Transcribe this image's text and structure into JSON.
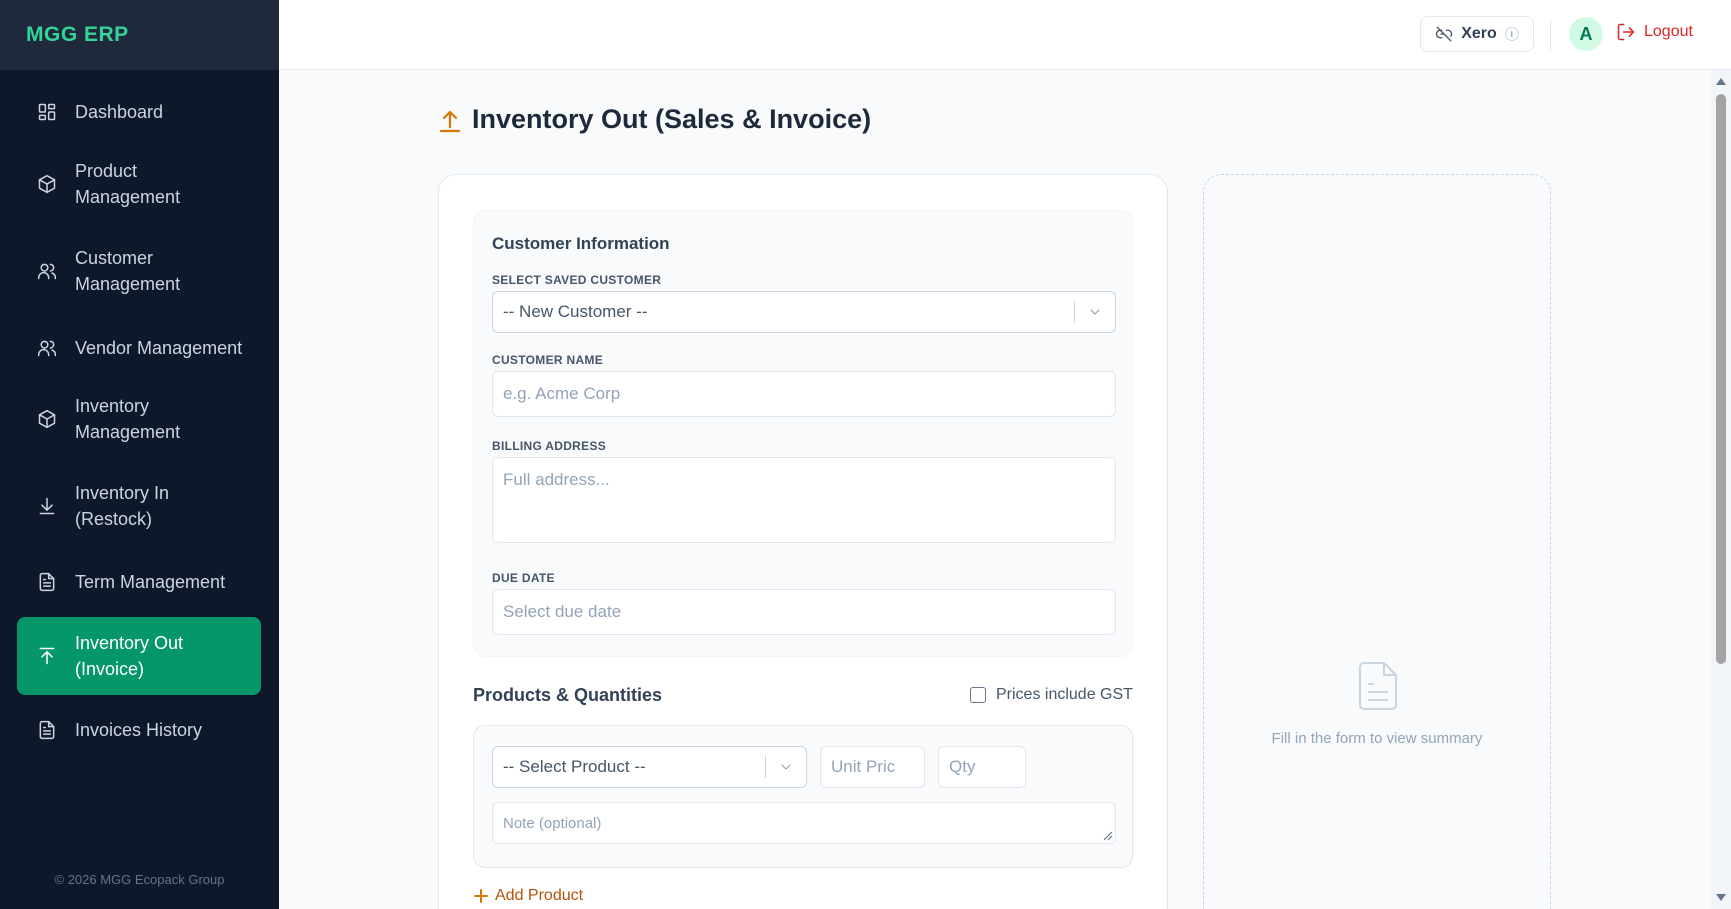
{
  "app": {
    "brand": "MGG ERP",
    "footer": "© 2026 MGG Ecopack Group"
  },
  "sidebar": {
    "items": [
      {
        "label": "Dashboard",
        "icon": "dashboard-icon"
      },
      {
        "label": "Product Management",
        "icon": "box-icon"
      },
      {
        "label": "Customer Management",
        "icon": "users-icon"
      },
      {
        "label": "Vendor Management",
        "icon": "users-icon"
      },
      {
        "label": "Inventory Management",
        "icon": "box-icon"
      },
      {
        "label": "Inventory In (Restock)",
        "icon": "download-icon"
      },
      {
        "label": "Term Management",
        "icon": "document-icon"
      },
      {
        "label": "Inventory Out (Invoice)",
        "icon": "upload-icon",
        "active": true
      },
      {
        "label": "Invoices History",
        "icon": "document-icon"
      }
    ]
  },
  "topbar": {
    "xero_label": "Xero",
    "avatar_initial": "A",
    "logout_label": "Logout"
  },
  "page": {
    "title": "Inventory Out (Sales & Invoice)"
  },
  "customer": {
    "section_title": "Customer Information",
    "saved_label": "SELECT SAVED CUSTOMER",
    "saved_value": "-- New Customer --",
    "name_label": "CUSTOMER NAME",
    "name_placeholder": "e.g. Acme Corp",
    "address_label": "BILLING ADDRESS",
    "address_placeholder": "Full address...",
    "due_label": "DUE DATE",
    "due_placeholder": "Select due date"
  },
  "products": {
    "title": "Products & Quantities",
    "gst_label": "Prices include GST",
    "product_select": "-- Select Product --",
    "unit_price_placeholder": "Unit Pric",
    "qty_placeholder": "Qty",
    "note_placeholder": "Note (optional)",
    "add_label": "Add Product"
  },
  "summary": {
    "empty_text": "Fill in the form to view summary"
  },
  "colors": {
    "accent": "#059669",
    "brand": "#34d399",
    "sidebar": "#0f172a",
    "warning": "#d97706",
    "danger": "#dc2626"
  }
}
